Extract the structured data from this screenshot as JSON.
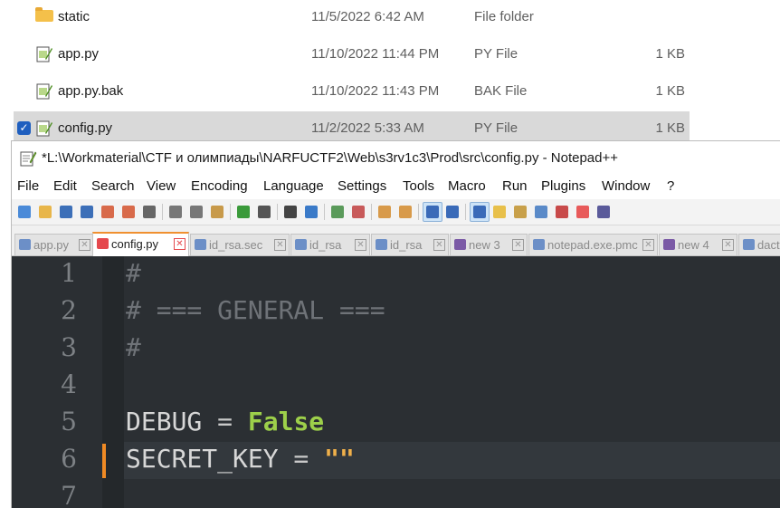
{
  "explorer": {
    "files": [
      {
        "name": "static",
        "date": "11/5/2022 6:42 AM",
        "type": "File folder",
        "size": "",
        "icon": "folder-icon",
        "selected": false
      },
      {
        "name": "app.py",
        "date": "11/10/2022 11:44 PM",
        "type": "PY File",
        "size": "1 KB",
        "icon": "notepadpp-file-icon",
        "selected": false
      },
      {
        "name": "app.py.bak",
        "date": "11/10/2022 11:43 PM",
        "type": "BAK File",
        "size": "1 KB",
        "icon": "notepadpp-file-icon",
        "selected": false
      },
      {
        "name": "config.py",
        "date": "11/2/2022 5:33 AM",
        "type": "PY File",
        "size": "1 KB",
        "icon": "notepadpp-file-icon",
        "selected": true
      }
    ]
  },
  "window": {
    "title": "*L:\\Workmaterial\\CTF и олимпиады\\NARFUCTF2\\Web\\s3rv1c3\\Prod\\src\\config.py - Notepad++"
  },
  "menu": [
    "File",
    "Edit",
    "Search",
    "View",
    "Encoding",
    "Language",
    "Settings",
    "Tools",
    "Macro",
    "Run",
    "Plugins",
    "Window",
    "?"
  ],
  "tabs": [
    {
      "label": "app.py",
      "icon": "blue",
      "active": false
    },
    {
      "label": "config.py",
      "icon": "red",
      "active": true
    },
    {
      "label": "id_rsa.sec",
      "icon": "blue",
      "active": false
    },
    {
      "label": "id_rsa",
      "icon": "blue",
      "active": false
    },
    {
      "label": "id_rsa",
      "icon": "blue",
      "active": false
    },
    {
      "label": "new 3",
      "icon": "purple",
      "active": false
    },
    {
      "label": "notepad.exe.pmc",
      "icon": "blue",
      "active": false
    },
    {
      "label": "new 4",
      "icon": "purple",
      "active": false
    },
    {
      "label": "dact",
      "icon": "blue",
      "active": false
    }
  ],
  "editor": {
    "lines": [
      {
        "num": "1",
        "tokens": [
          {
            "t": "#",
            "c": "comment"
          }
        ]
      },
      {
        "num": "2",
        "tokens": [
          {
            "t": "# === GENERAL ===",
            "c": "comment"
          }
        ]
      },
      {
        "num": "3",
        "tokens": [
          {
            "t": "#",
            "c": "comment"
          }
        ]
      },
      {
        "num": "4",
        "tokens": []
      },
      {
        "num": "5",
        "tokens": [
          {
            "t": "DEBUG",
            "c": "ident"
          },
          {
            "t": " = ",
            "c": "op"
          },
          {
            "t": "False",
            "c": "kw"
          }
        ]
      },
      {
        "num": "6",
        "tokens": [
          {
            "t": "SECRET_KEY",
            "c": "ident"
          },
          {
            "t": " = ",
            "c": "op"
          },
          {
            "t": "\"\"",
            "c": "str"
          }
        ],
        "current": true,
        "changed": true
      },
      {
        "num": "7",
        "tokens": []
      }
    ]
  },
  "colors": {
    "accent_tab": "#f09030",
    "keyword": "#9dd04a",
    "string": "#f0b04a",
    "editor_bg": "#2b2f33"
  }
}
